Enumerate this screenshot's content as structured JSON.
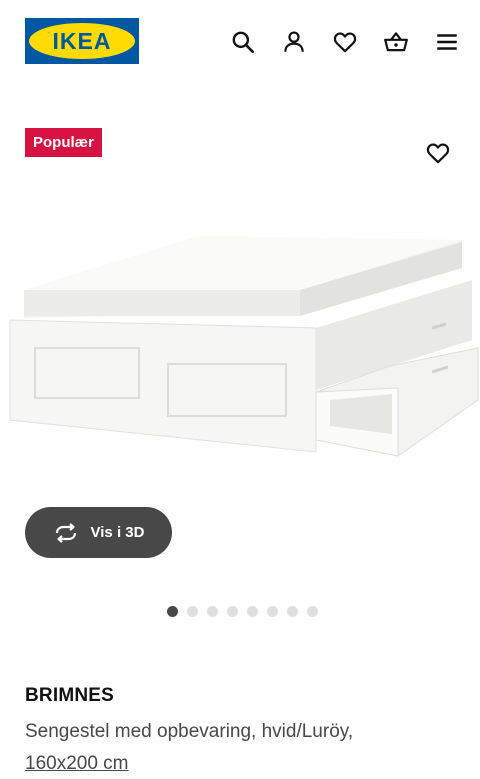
{
  "header": {
    "logo_text": "IKEA",
    "icons": [
      "search-icon",
      "user-icon",
      "heart-icon",
      "basket-icon",
      "menu-icon"
    ]
  },
  "badge": {
    "label": "Populær",
    "color": "#d51242"
  },
  "view3d": {
    "label": "Vis i 3D"
  },
  "carousel": {
    "total": 8,
    "active_index": 0
  },
  "product": {
    "name": "BRIMNES",
    "description": "Sengestel med opbevaring, hvid/Luröy,",
    "size": "160x200 cm"
  },
  "colors": {
    "brand_blue": "#0058a3",
    "brand_yellow": "#ffdb00",
    "badge_red": "#d51242",
    "dark_gray": "#484848"
  }
}
